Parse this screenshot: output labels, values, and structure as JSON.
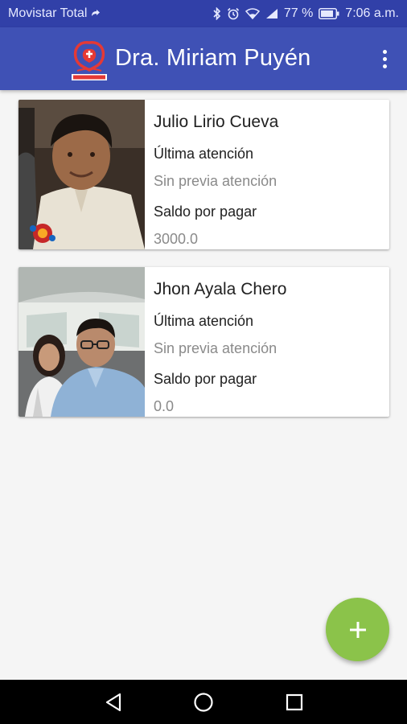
{
  "status_bar": {
    "carrier": "Movistar Total",
    "battery_percent": "77 %",
    "time": "7:06 a.m.",
    "icons": [
      "call-forward-icon",
      "bluetooth-icon",
      "alarm-icon",
      "wifi-icon",
      "signal-icon",
      "battery-icon"
    ]
  },
  "app_bar": {
    "title": "Dra. Miriam Puyén",
    "logo_icon": "dentistry-logo-icon",
    "menu_icon": "more-vertical-icon"
  },
  "patients": [
    {
      "name": "Julio Lirio Cueva",
      "last_visit_label": "Última atención",
      "last_visit_value": "Sin previa atención",
      "balance_label": "Saldo por pagar",
      "balance_value": "3000.0"
    },
    {
      "name": "Jhon Ayala Chero",
      "last_visit_label": "Última atención",
      "last_visit_value": "Sin previa atención",
      "balance_label": "Saldo por pagar",
      "balance_value": "0.0"
    }
  ],
  "fab": {
    "icon": "add-icon"
  },
  "colors": {
    "status_bar": "#3140a8",
    "app_bar": "#3f51b5",
    "fab": "#8bc34a",
    "background": "#f5f5f5",
    "nav_bar": "#000000"
  },
  "nav_bar": {
    "icons": [
      "back-icon",
      "home-icon",
      "recents-icon"
    ]
  }
}
